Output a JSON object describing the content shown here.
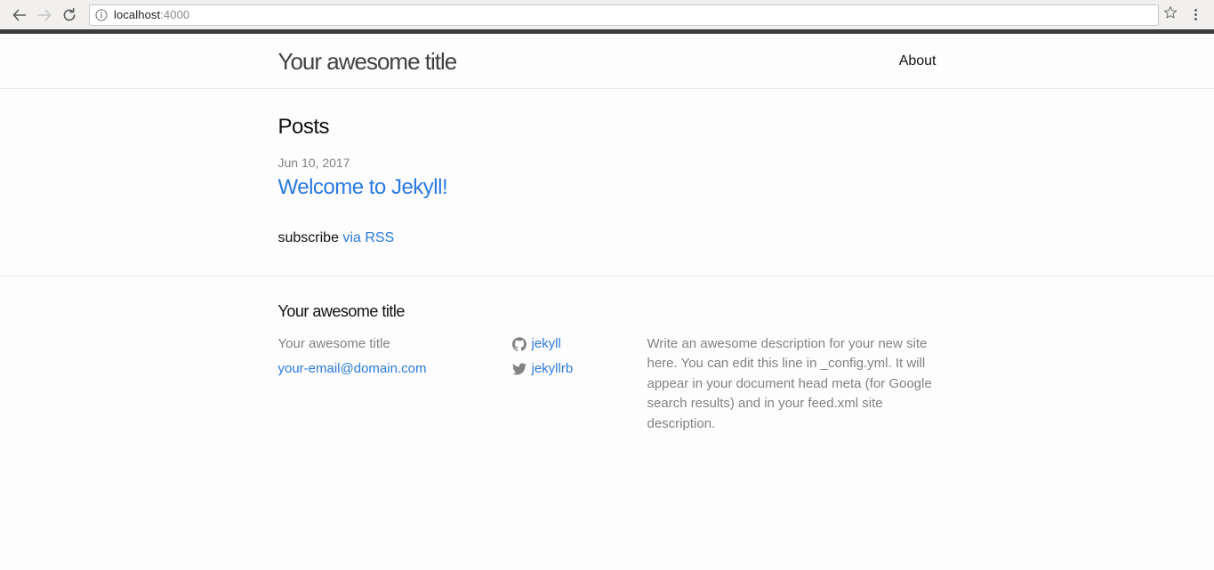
{
  "browser": {
    "back_icon": "back-arrow-icon",
    "forward_icon": "forward-arrow-icon",
    "reload_icon": "reload-icon",
    "info_icon": "info-circle-icon",
    "star_icon": "bookmark-star-icon",
    "menu_icon": "three-dot-menu-icon",
    "url_host": "localhost",
    "url_port": ":4000",
    "url_full": "localhost:4000"
  },
  "header": {
    "site_title": "Your awesome title",
    "nav": [
      {
        "label": "About"
      }
    ]
  },
  "content": {
    "posts_heading": "Posts",
    "posts": [
      {
        "date": "Jun 10, 2017",
        "title": "Welcome to Jekyll!"
      }
    ],
    "subscribe_text": "subscribe ",
    "subscribe_link": "via RSS"
  },
  "footer": {
    "heading": "Your awesome title",
    "contact": {
      "name": "Your awesome title",
      "email": "your-email@domain.com"
    },
    "social": [
      {
        "icon": "github-icon",
        "label": "jekyll"
      },
      {
        "icon": "twitter-icon",
        "label": "jekyllrb"
      }
    ],
    "description": "Write an awesome description for your new site here. You can edit this line in _config.yml. It will appear in your document head meta (for Google search results) and in your feed.xml site description."
  },
  "colors": {
    "link": "#2a7ae2",
    "text": "#111111",
    "muted": "#828282",
    "title": "#424242",
    "page_bg": "#fdfdfd",
    "border": "#e8e8e8"
  }
}
